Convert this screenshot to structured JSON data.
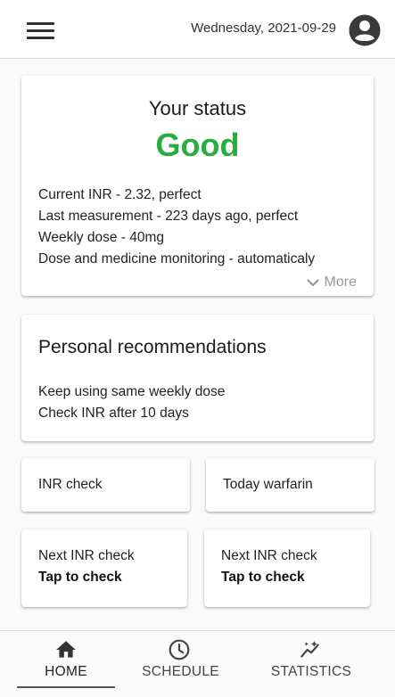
{
  "header": {
    "date": "Wednesday, 2021-09-29",
    "menu_icon": "hamburger-menu-icon",
    "avatar_icon": "account-circle-icon"
  },
  "status": {
    "title": "Your status",
    "value": "Good",
    "value_color": "#27ae3f",
    "lines": [
      "Current INR - 2.32, perfect",
      "Last measurement - 223 days ago, perfect",
      "Weekly dose - 40mg",
      "Dose and medicine monitoring - automaticaly"
    ],
    "more_label": "More",
    "more_icon": "chevron-down-icon"
  },
  "recommendations": {
    "title": "Personal recommendations",
    "lines": [
      "Keep using same weekly dose",
      "Check INR after 10 days"
    ]
  },
  "actions": {
    "inr_check": "INR check",
    "today_warfarin": "Today warfarin"
  },
  "next_checks": [
    {
      "line1": "Next INR check",
      "line2": "Tap to check"
    },
    {
      "line1": "Next INR check",
      "line2": "Tap to check"
    }
  ],
  "bottom_nav": [
    {
      "label": "HOME",
      "icon": "home-icon",
      "active": true
    },
    {
      "label": "SCHEDULE",
      "icon": "clock-icon",
      "active": false
    },
    {
      "label": "STATISTICS",
      "icon": "statistics-icon",
      "active": false
    }
  ]
}
